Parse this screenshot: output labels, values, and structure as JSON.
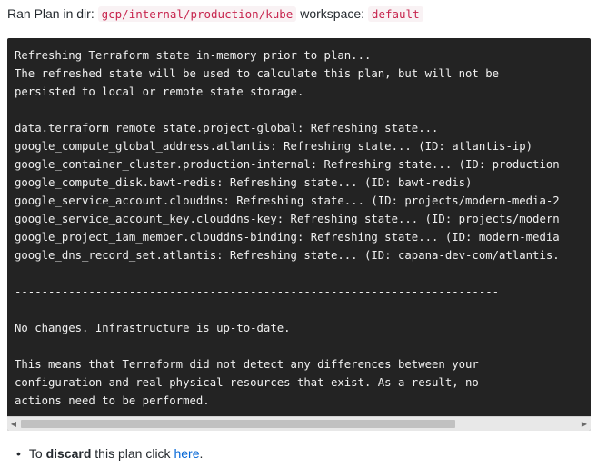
{
  "header": {
    "prefix": "Ran Plan in dir:",
    "dir": "gcp/internal/production/kube",
    "workspace_label": "workspace:",
    "workspace": "default"
  },
  "terminal": {
    "lines": [
      "Refreshing Terraform state in-memory prior to plan...",
      "The refreshed state will be used to calculate this plan, but will not be",
      "persisted to local or remote state storage.",
      "",
      "data.terraform_remote_state.project-global: Refreshing state...",
      "google_compute_global_address.atlantis: Refreshing state... (ID: atlantis-ip)",
      "google_container_cluster.production-internal: Refreshing state... (ID: production",
      "google_compute_disk.bawt-redis: Refreshing state... (ID: bawt-redis)",
      "google_service_account.clouddns: Refreshing state... (ID: projects/modern-media-2",
      "google_service_account_key.clouddns-key: Refreshing state... (ID: projects/modern",
      "google_project_iam_member.clouddns-binding: Refreshing state... (ID: modern-media",
      "google_dns_record_set.atlantis: Refreshing state... (ID: capana-dev-com/atlantis.",
      "",
      "------------------------------------------------------------------------",
      "",
      "No changes. Infrastructure is up-to-date.",
      "",
      "This means that Terraform did not detect any differences between your",
      "configuration and real physical resources that exist. As a result, no",
      "actions need to be performed."
    ]
  },
  "scrollbar": {
    "left_arrow": "◀",
    "right_arrow": "▶"
  },
  "discard": {
    "prefix": "To ",
    "bold": "discard",
    "middle": " this plan click ",
    "link": "here",
    "suffix": "."
  }
}
